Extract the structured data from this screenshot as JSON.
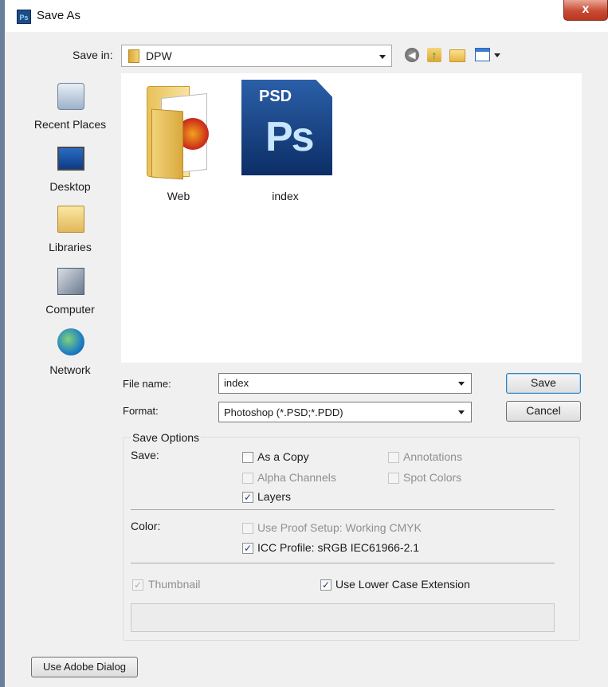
{
  "window": {
    "title": "Save As",
    "app_icon": "Ps",
    "close_label": "x"
  },
  "save_in": {
    "label": "Save in:",
    "value": "DPW"
  },
  "toolbar": {
    "icons": [
      "back-icon",
      "up-folder-icon",
      "new-folder-icon",
      "views-menu-icon"
    ]
  },
  "places": [
    {
      "label": "Recent Places",
      "icon": "recent-places-icon"
    },
    {
      "label": "Desktop",
      "icon": "desktop-icon"
    },
    {
      "label": "Libraries",
      "icon": "libraries-icon"
    },
    {
      "label": "Computer",
      "icon": "computer-icon"
    },
    {
      "label": "Network",
      "icon": "network-icon"
    }
  ],
  "files": [
    {
      "name": "Web",
      "icon": "folder-icon",
      "badge": "Adobe"
    },
    {
      "name": "index",
      "icon": "psd-file-icon",
      "badge": "PSD",
      "glyph": "Ps"
    }
  ],
  "file_name": {
    "label": "File name:",
    "value": "index"
  },
  "format": {
    "label": "Format:",
    "value": "Photoshop (*.PSD;*.PDD)"
  },
  "buttons": {
    "save": "Save",
    "cancel": "Cancel",
    "use_adobe_dialog": "Use Adobe Dialog"
  },
  "save_options": {
    "title": "Save Options",
    "save_label": "Save:",
    "as_a_copy": {
      "label": "As a Copy",
      "checked": false,
      "enabled": true
    },
    "annotations": {
      "label": "Annotations",
      "checked": false,
      "enabled": false
    },
    "alpha_channels": {
      "label": "Alpha Channels",
      "checked": false,
      "enabled": false
    },
    "spot_colors": {
      "label": "Spot Colors",
      "checked": false,
      "enabled": false
    },
    "layers": {
      "label": "Layers",
      "checked": true,
      "enabled": true
    },
    "color_label": "Color:",
    "use_proof_setup": {
      "label": "Use Proof Setup:  Working CMYK",
      "checked": false,
      "enabled": false
    },
    "icc_profile": {
      "label": "ICC Profile:  sRGB IEC61966-2.1",
      "checked": true,
      "enabled": true
    },
    "thumbnail": {
      "label": "Thumbnail",
      "checked": true,
      "enabled": false
    },
    "lower_case_ext": {
      "label": "Use Lower Case Extension",
      "checked": true,
      "enabled": true
    }
  },
  "check_mark": "✓"
}
